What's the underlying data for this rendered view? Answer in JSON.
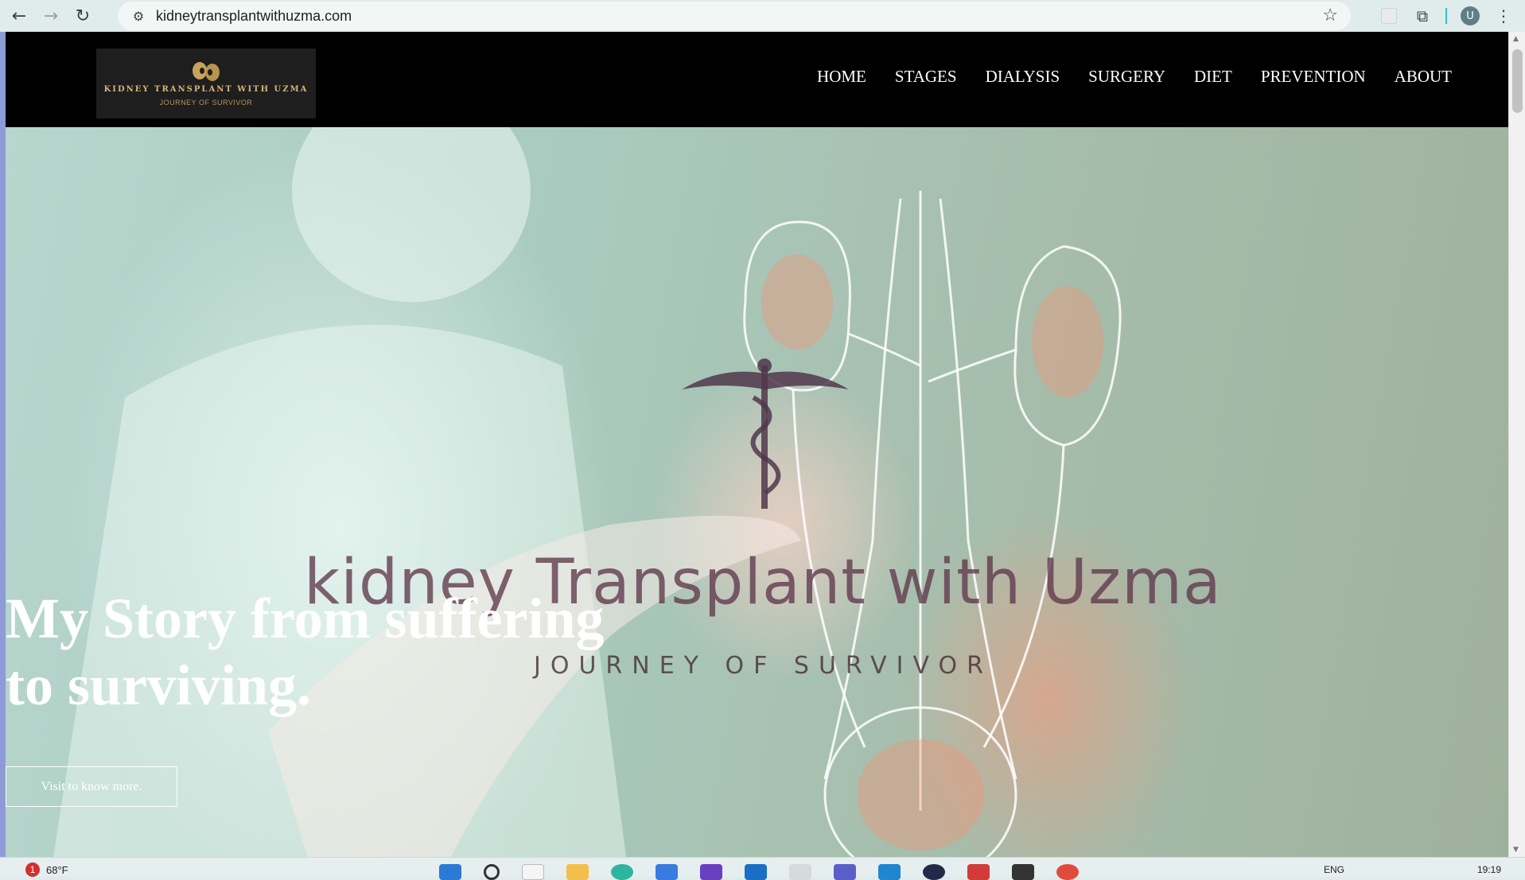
{
  "browser": {
    "url": "kidneytransplantwithuzma.com",
    "profile_initial": "U",
    "icons": [
      "back-arrow-icon",
      "forward-arrow-icon",
      "reload-icon",
      "site-info-icon",
      "bookmark-star-icon",
      "extension-icon",
      "puzzle-extensions-icon",
      "profile-avatar",
      "more-menu-icon"
    ]
  },
  "site": {
    "logo": {
      "title": "KIDNEY TRANSPLANT WITH UZMA",
      "subtitle": "JOURNEY OF SURVIVOR"
    },
    "menu": [
      {
        "label": "HOME"
      },
      {
        "label": "STAGES"
      },
      {
        "label": "DIALYSIS"
      },
      {
        "label": "SURGERY"
      },
      {
        "label": "DIET"
      },
      {
        "label": "PREVENTION"
      },
      {
        "label": "ABOUT"
      }
    ]
  },
  "hero": {
    "watermark_title": "kidney Transplant with Uzma",
    "watermark_subtitle": "JOURNEY OF SURVIVOR",
    "heading_line1": "My Story from suffering",
    "heading_line2": "to surviving.",
    "button_label": "Visit to know more."
  },
  "taskbar": {
    "weather_badge": "1",
    "weather_temp": "68°F",
    "language": "ENG",
    "time": "19:19"
  },
  "colors": {
    "header_bg": "#000000",
    "menu_text": "#ffffff",
    "logo_gold": "#d7b474",
    "hero_text": "#ffffff",
    "watermark": "#5f374b"
  }
}
